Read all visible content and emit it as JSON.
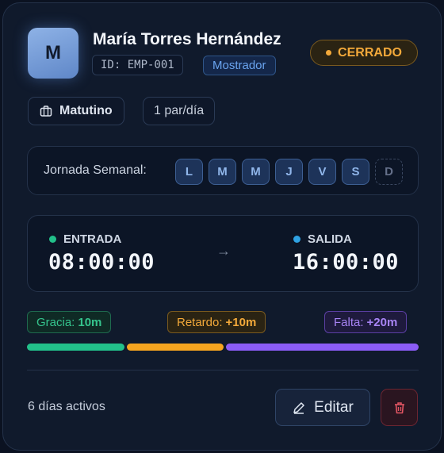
{
  "employee": {
    "initial": "M",
    "name": "María Torres Hernández",
    "id_label": "ID: EMP-001",
    "department": "Mostrador",
    "status": "CERRADO",
    "status_color": "#f3a93a"
  },
  "chips": {
    "shift_icon": "briefcase-icon",
    "shift": "Matutino",
    "pairs": "1 par/día"
  },
  "week": {
    "label": "Jornada Semanal:",
    "days": [
      {
        "letter": "L",
        "active": true
      },
      {
        "letter": "M",
        "active": true
      },
      {
        "letter": "M",
        "active": true
      },
      {
        "letter": "J",
        "active": true
      },
      {
        "letter": "V",
        "active": true
      },
      {
        "letter": "S",
        "active": true
      },
      {
        "letter": "D",
        "active": false
      }
    ]
  },
  "schedule": {
    "entry_label": "ENTRADA",
    "entry_time": "08:00:00",
    "entry_color": "#22c08a",
    "exit_label": "SALIDA",
    "exit_time": "16:00:00",
    "exit_color": "#2fa2e3",
    "arrow_icon": "arrow-right-icon"
  },
  "tolerance": {
    "grace_label": "Gracia:",
    "grace_value": "10m",
    "late_label": "Retardo:",
    "late_value": "+10m",
    "absence_label": "Falta:",
    "absence_value": "+20m",
    "colors": {
      "grace": "#22c08a",
      "late": "#f5a41f",
      "absence": "#8b5cf6"
    }
  },
  "footer": {
    "active_days": "6 días activos",
    "edit_label": "Editar",
    "edit_icon": "pencil-icon",
    "delete_icon": "trash-icon"
  }
}
